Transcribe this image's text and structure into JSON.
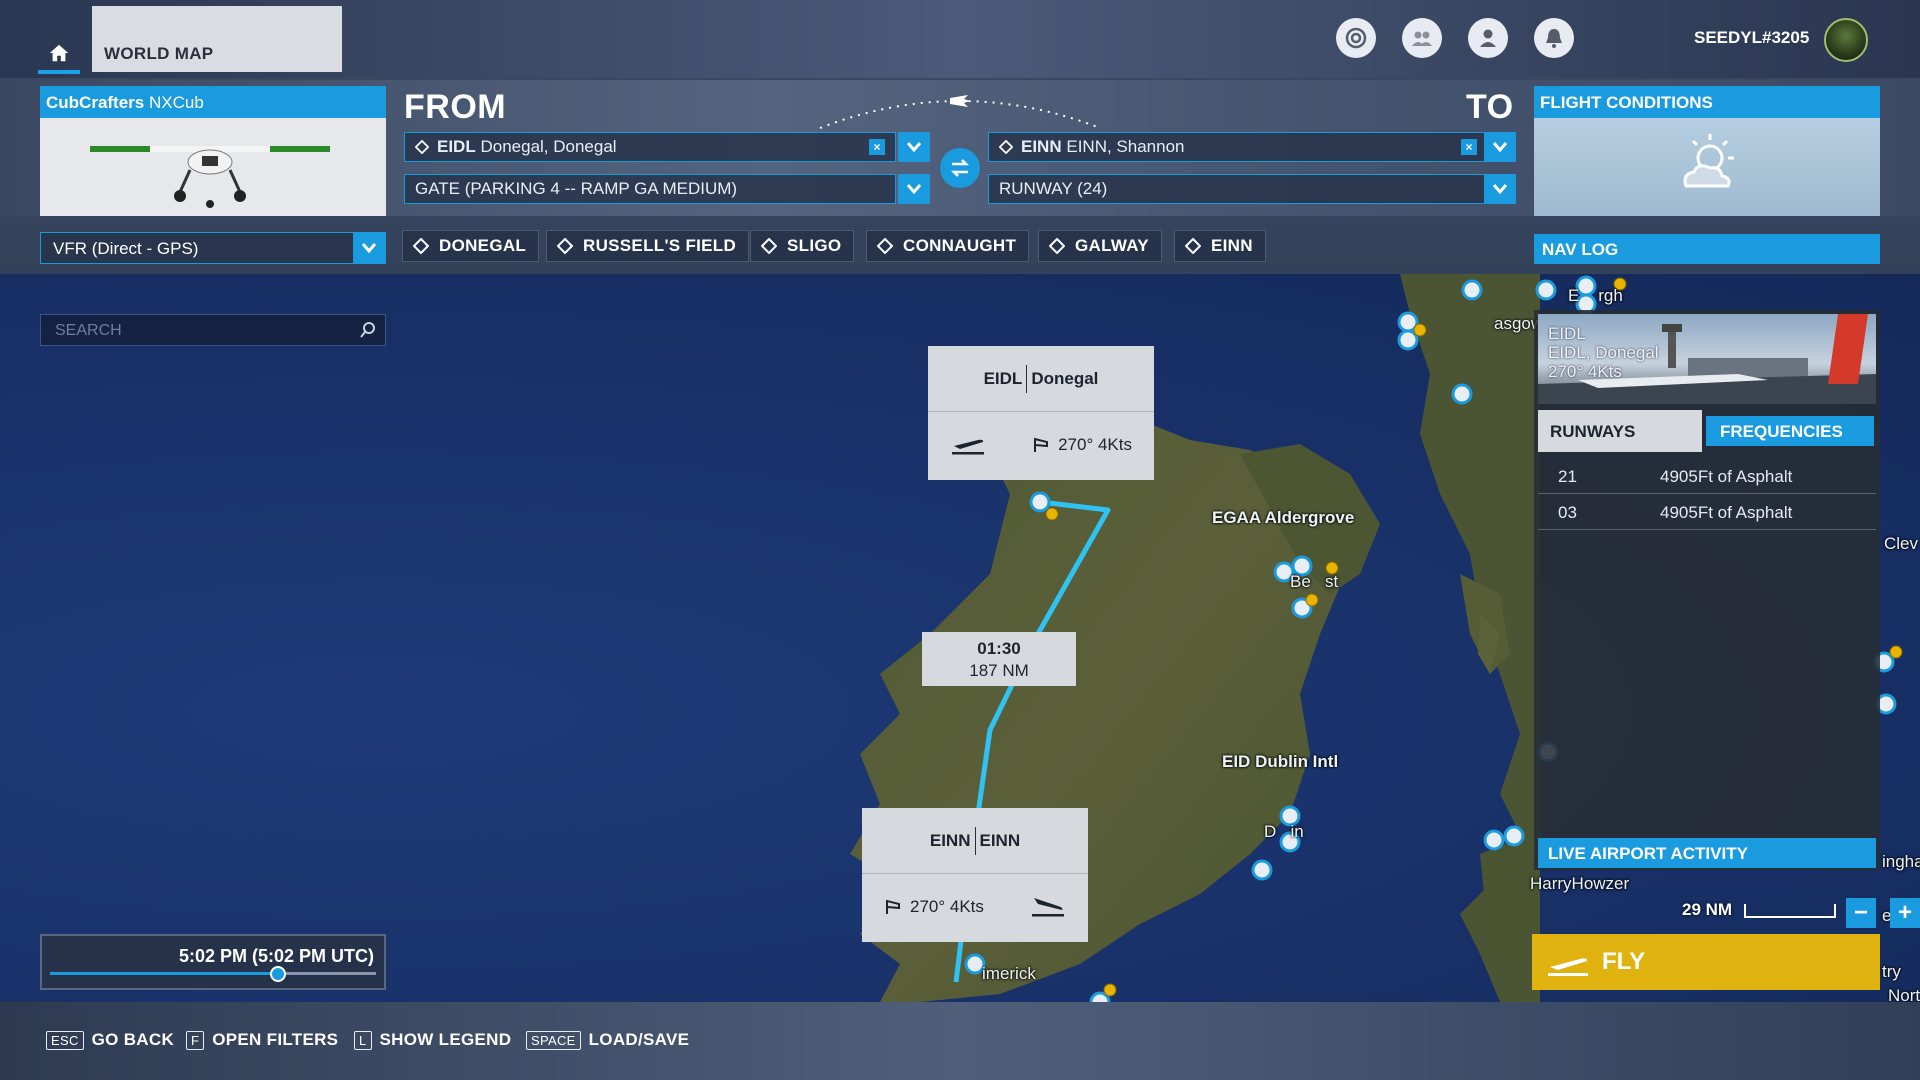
{
  "topbar": {
    "home_icon": "home-icon",
    "tab_label": "WORLD MAP",
    "icons": [
      "activity-icon",
      "friends-icon",
      "profile-icon",
      "notifications-icon"
    ],
    "username": "SEEDYL#3205"
  },
  "aircraft": {
    "make": "CubCrafters",
    "model": "NXCub"
  },
  "route": {
    "from_label": "FROM",
    "to_label": "TO",
    "from_code": "EIDL",
    "from_name": "Donegal, Donegal",
    "from_spot": "GATE (PARKING 4 -- RAMP GA MEDIUM)",
    "to_code": "EINN",
    "to_name": "EINN, Shannon",
    "to_spot": "RUNWAY (24)",
    "clear_symbol": "×",
    "swap_icon": "swap-icon"
  },
  "conditions": {
    "title": "FLIGHT CONDITIONS",
    "weather_icon": "partly-cloudy-icon"
  },
  "flight_plan": {
    "type": "VFR (Direct - GPS)",
    "waypoints": [
      "DONEGAL",
      "RUSSELL'S FIELD",
      "SLIGO",
      "CONNAUGHT",
      "GALWAY",
      "EINN"
    ]
  },
  "navlog": {
    "label": "NAV LOG"
  },
  "search": {
    "placeholder": "SEARCH"
  },
  "departure_card": {
    "code": "EIDL",
    "name": "Donegal",
    "wind": "270° 4Kts"
  },
  "arrival_card": {
    "code": "EINN",
    "name": "EINN",
    "wind": "270° 4Kts"
  },
  "leg": {
    "time": "01:30",
    "distance": "187 NM"
  },
  "map_labels": {
    "egaa_code": "EGAA",
    "egaa_name": "Aldergrove",
    "dublin_code": "EID",
    "dublin_name": "Dublin Intl",
    "glasgow": "asgow",
    "edinburgh": "E    rgh",
    "belfast": "Be   st",
    "dublin": "D   in",
    "limerick": "imerick",
    "harry": "HarryHowzer",
    "clev": "Clev",
    "ingha": "ingha",
    "try": "try",
    "nort": "Nort",
    "leic": "eic"
  },
  "detail": {
    "code": "EIDL",
    "name": "EIDL, Donegal",
    "wind": "270° 4Kts",
    "tab_runways": "RUNWAYS",
    "tab_frequencies": "FREQUENCIES",
    "runways": [
      {
        "num": "21",
        "desc": "4905Ft of Asphalt"
      },
      {
        "num": "03",
        "desc": "4905Ft of Asphalt"
      }
    ],
    "live_label": "LIVE AIRPORT ACTIVITY"
  },
  "scale": {
    "label": "29 NM",
    "zoom_out": "−",
    "zoom_in": "+"
  },
  "fly": {
    "label": "FLY"
  },
  "time": {
    "label": "5:02 PM (5:02 PM UTC)",
    "fraction": 0.7
  },
  "hints": [
    {
      "key": "ESC",
      "label": "GO BACK"
    },
    {
      "key": "F",
      "label": "OPEN FILTERS"
    },
    {
      "key": "L",
      "label": "SHOW LEGEND"
    },
    {
      "key": "SPACE",
      "label": "LOAD/SAVE"
    }
  ],
  "colors": {
    "accent": "#1a9be0",
    "fly": "#dfb20f",
    "route_line": "#2fc3f3"
  }
}
